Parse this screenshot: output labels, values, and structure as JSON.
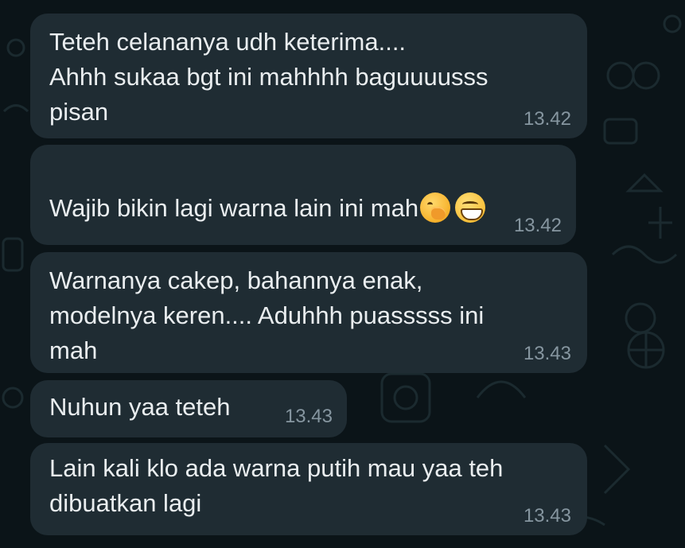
{
  "messages": [
    {
      "text": "Teteh celananya udh keterima....\nAhhh sukaa bgt ini mahhhh baguuuusss\npisan",
      "time": "13.42"
    },
    {
      "text": "Wajib bikin lagi warna lain ini mah",
      "time": "13.42",
      "emojis": [
        "face-with-hand-over-mouth-icon",
        "grinning-face-icon"
      ]
    },
    {
      "text": "Warnanya cakep, bahannya enak,\nmodelnya keren.... Aduhhh puasssss ini\nmah",
      "time": "13.43"
    },
    {
      "text": "Nuhun yaa teteh",
      "time": "13.43"
    },
    {
      "text": "Lain kali klo ada warna putih mau yaa teh\ndibuatkan lagi",
      "time": "13.43"
    }
  ],
  "colors": {
    "background": "#0b1418",
    "bubble": "#1f2c33",
    "text": "#e9edef",
    "time": "#8696a0"
  }
}
